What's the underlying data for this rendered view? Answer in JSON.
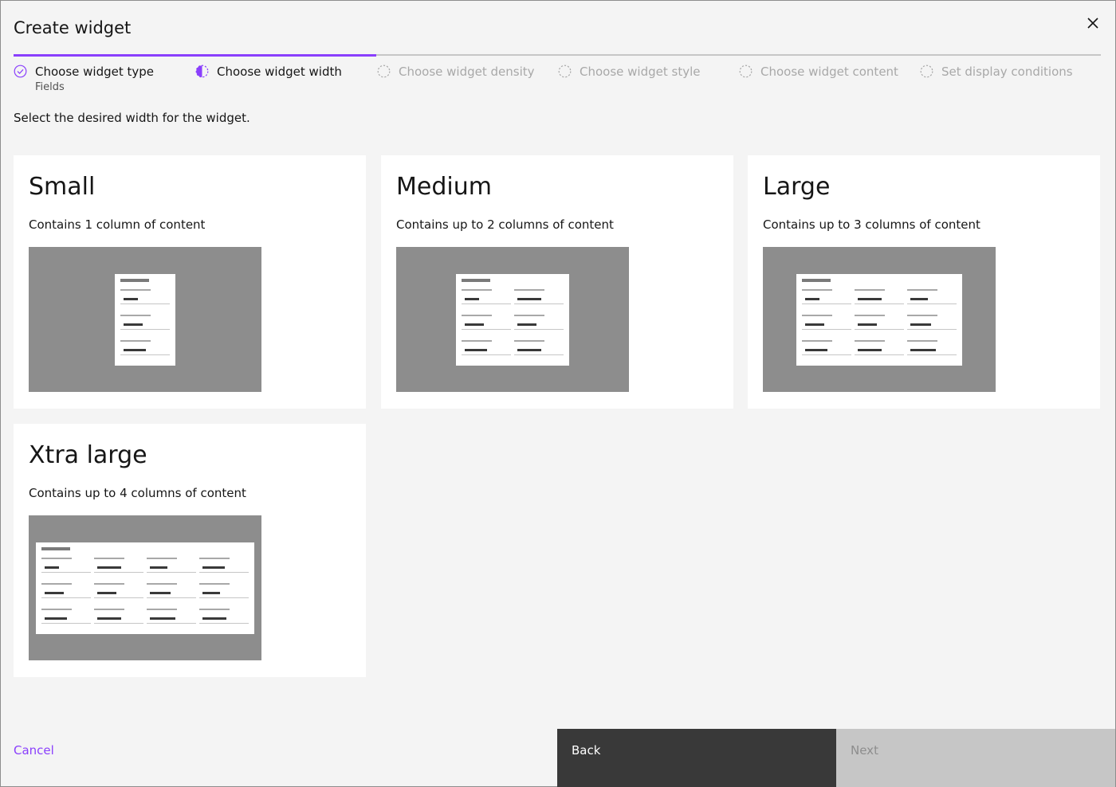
{
  "dialog": {
    "title": "Create widget",
    "close_label": "close"
  },
  "progress": {
    "steps": [
      {
        "label": "Choose widget type",
        "sublabel": "Fields",
        "state": "complete"
      },
      {
        "label": "Choose widget width",
        "state": "current"
      },
      {
        "label": "Choose widget density",
        "state": "incomplete"
      },
      {
        "label": "Choose widget style",
        "state": "incomplete"
      },
      {
        "label": "Choose widget content",
        "state": "incomplete"
      },
      {
        "label": "Set display conditions",
        "state": "incomplete"
      }
    ]
  },
  "intro": "Select the desired width for the widget.",
  "options": [
    {
      "title": "Small",
      "description": "Contains 1 column of content",
      "columns": 1
    },
    {
      "title": "Medium",
      "description": "Contains up to 2 columns of content",
      "columns": 2
    },
    {
      "title": "Large",
      "description": "Contains up to 3 columns of content",
      "columns": 3
    },
    {
      "title": "Xtra large",
      "description": "Contains up to 4 columns of content",
      "columns": 4
    }
  ],
  "footer": {
    "cancel_label": "Cancel",
    "back_label": "Back",
    "next_label": "Next"
  },
  "colors": {
    "accent": "#8a3ffc",
    "primary_button": "#393939",
    "disabled_button": "#c6c6c6",
    "thumb_background": "#8d8d8d"
  }
}
